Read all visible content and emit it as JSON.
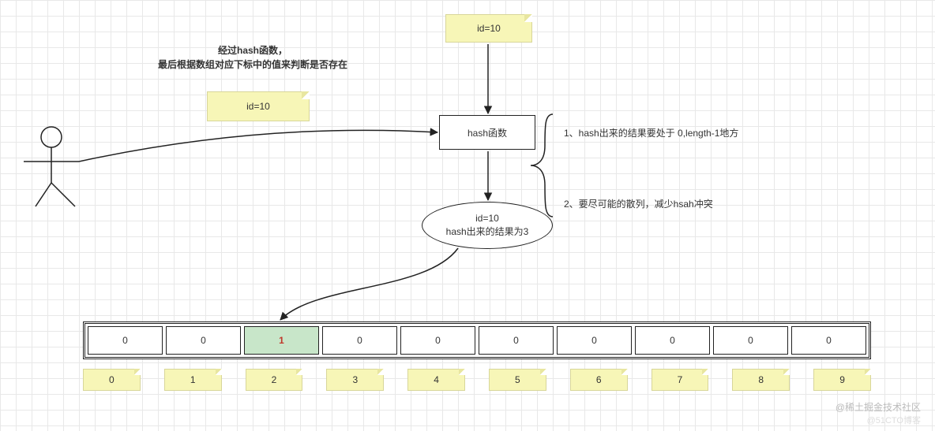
{
  "caption": {
    "line1": "经过hash函数，",
    "line2": "最后根据数组对应下标中的值来判断是否存在"
  },
  "notes": {
    "top_id": "id=10",
    "left_id": "id=10"
  },
  "hash_box": "hash函数",
  "ellipse": {
    "line1": "id=10",
    "line2": "hash出来的结果为3"
  },
  "rules": {
    "r1": "1、hash出来的结果要处于 0,length-1地方",
    "r2": "2、要尽可能的散列，减少hsah冲突"
  },
  "chart_data": {
    "type": "table",
    "title": "hash array slots",
    "indices": [
      0,
      1,
      2,
      3,
      4,
      5,
      6,
      7,
      8,
      9
    ],
    "values": [
      0,
      0,
      1,
      0,
      0,
      0,
      0,
      0,
      0,
      0
    ],
    "highlight_index": 2,
    "input_id": 10,
    "hash_result": 3
  },
  "watermarks": {
    "w1": "@稀土掘金技术社区",
    "w2": "@51CTO博客"
  }
}
